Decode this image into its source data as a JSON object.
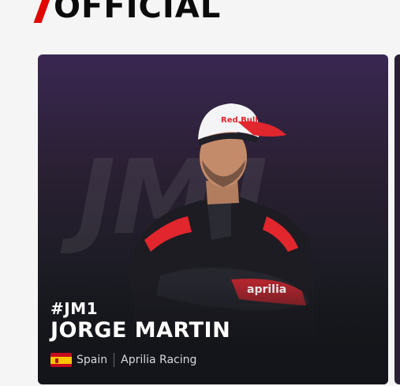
{
  "heading": {
    "title": "OFFICIAL"
  },
  "rider": {
    "tag": "#JM1",
    "watermark": "JM1",
    "name": "JORGE MARTIN",
    "country": "Spain",
    "team": "Aprilia Racing",
    "flag_icon": "spain-flag-icon"
  },
  "colors": {
    "accent": "#e10600",
    "card_top": "#3a2752",
    "card_bottom": "#14151a",
    "cap_red": "#e1262d"
  }
}
